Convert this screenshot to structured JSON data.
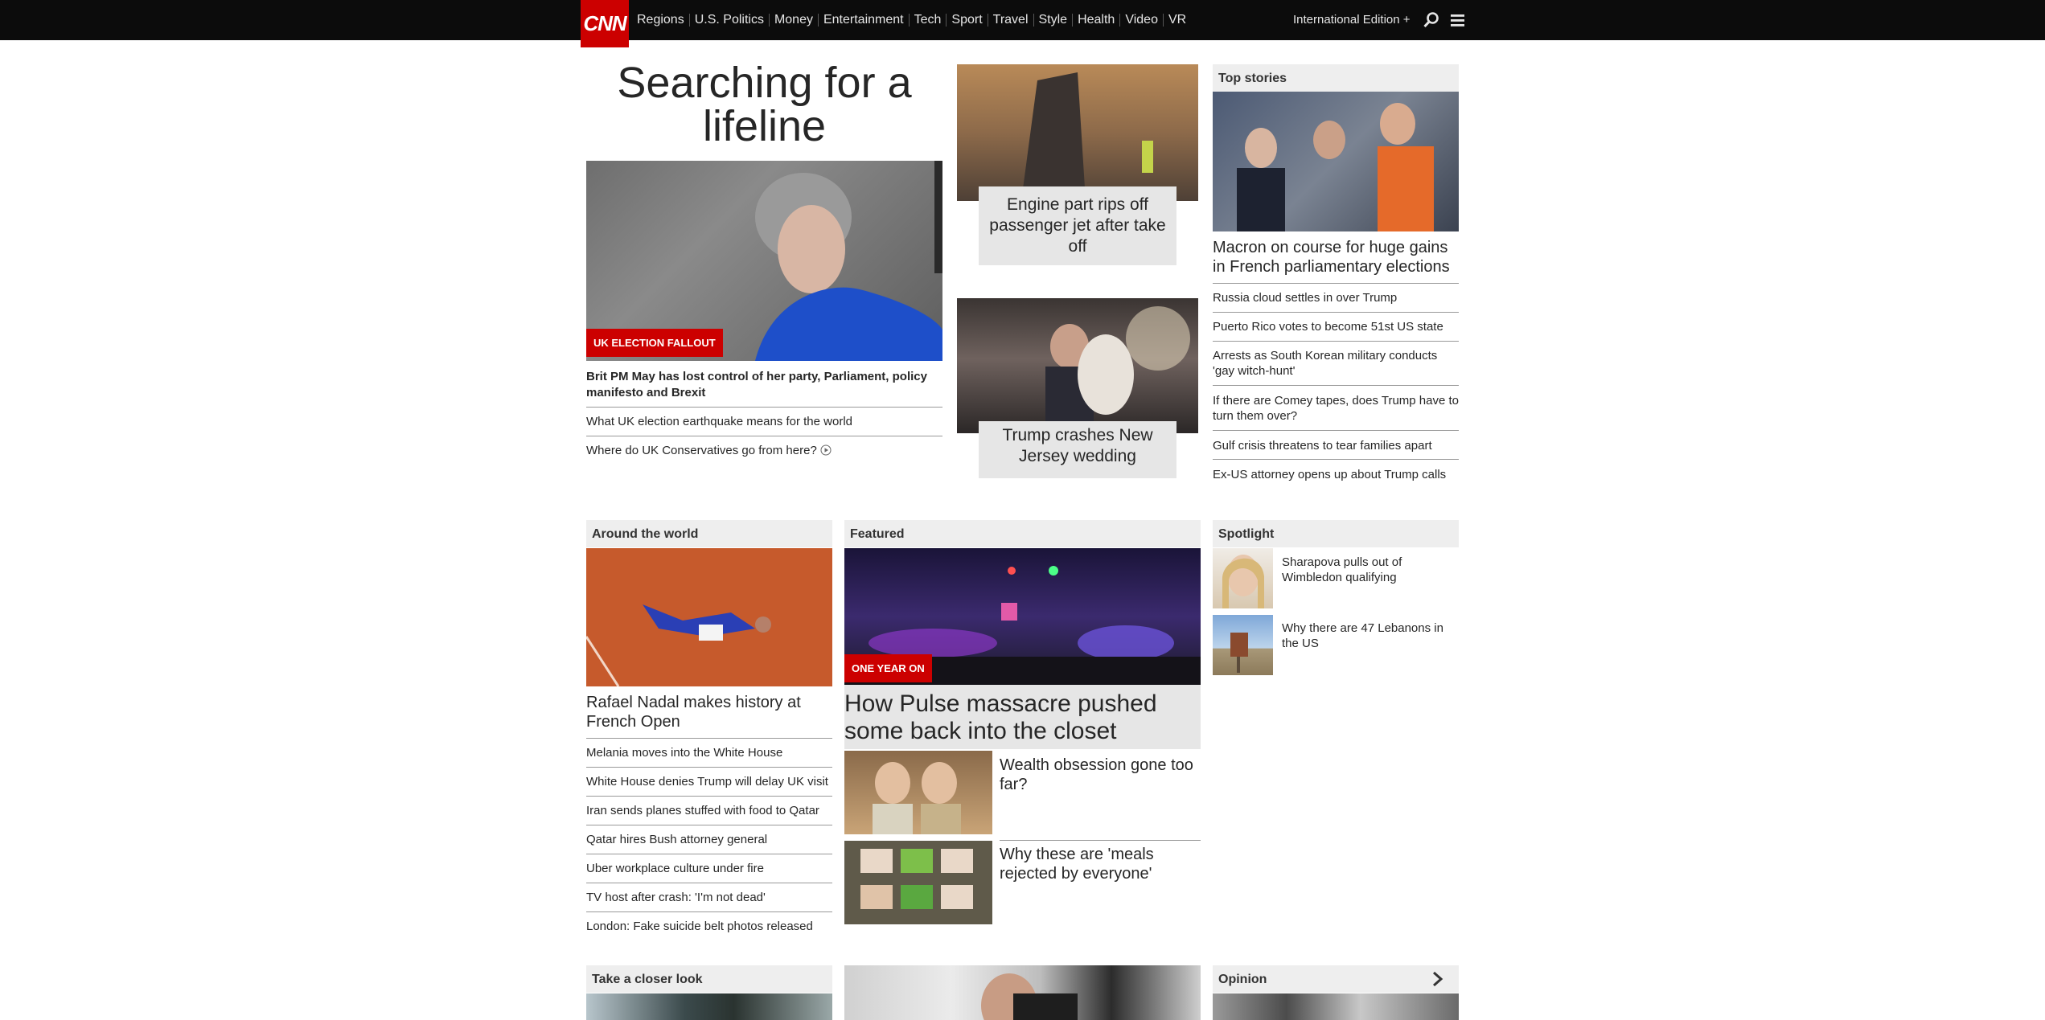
{
  "nav": {
    "logo": "CNN",
    "links": [
      "Regions",
      "U.S. Politics",
      "Money",
      "Entertainment",
      "Tech",
      "Sport",
      "Travel",
      "Style",
      "Health",
      "Video",
      "VR"
    ],
    "edition": "International Edition +",
    "search_icon": "search-icon",
    "menu_icon": "menu-icon"
  },
  "lead": {
    "headline": "Searching for a lifeline",
    "label": "UK ELECTION FALLOUT",
    "main_story": "Brit PM May has lost control of her party, Parliament, policy manifesto and Brexit",
    "related": [
      "What UK election earthquake means for the world",
      "Where do UK Conservatives go from here?"
    ]
  },
  "middle_cards": [
    {
      "title": "Engine part rips off passenger jet after take off"
    },
    {
      "title": "Trump crashes New Jersey wedding"
    }
  ],
  "top_stories": {
    "heading": "Top stories",
    "main": "Macron on course for huge gains in French parliamentary elections",
    "items": [
      "Russia cloud settles in over Trump",
      "Puerto Rico votes to become 51st US state",
      "Arrests as South Korean military conducts 'gay witch-hunt'",
      "If there are Comey tapes, does Trump have to turn them over?",
      "Gulf crisis threatens to tear families apart",
      "Ex-US attorney opens up about Trump calls"
    ]
  },
  "around_world": {
    "heading": "Around the world",
    "main": "Rafael Nadal makes history at French Open",
    "items": [
      "Melania moves into the White House",
      "White House denies Trump will delay UK visit",
      "Iran sends planes stuffed with food to Qatar",
      "Qatar hires Bush attorney general",
      "Uber workplace culture under fire",
      "TV host after crash: 'I'm not dead'",
      "London: Fake suicide belt photos released"
    ]
  },
  "featured": {
    "heading": "Featured",
    "label": "ONE YEAR ON",
    "main": "How Pulse massacre pushed some back into the closet",
    "items": [
      "Wealth obsession gone too far?",
      "Why these are 'meals rejected by everyone'"
    ]
  },
  "spotlight": {
    "heading": "Spotlight",
    "items": [
      "Sharapova pulls out of Wimbledon qualifying",
      "Why there are 47 Lebanons in the US"
    ]
  },
  "bottom": {
    "closer_look": "Take a closer look",
    "opinion": "Opinion"
  }
}
